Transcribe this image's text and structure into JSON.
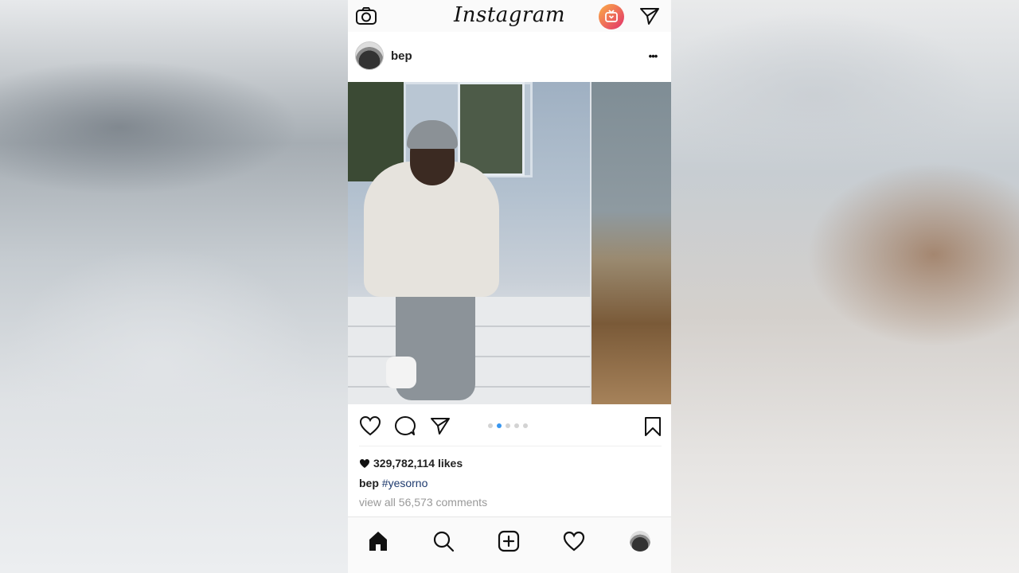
{
  "app": {
    "title": "Instagram"
  },
  "post": {
    "username": "bep",
    "more_label": "•••",
    "likes": "329,782,114 likes",
    "caption_user": "bep",
    "caption_tag": "#yesorno",
    "view_comments": "view all 56,573 comments"
  },
  "carousel": {
    "count": 5,
    "active_index": 1
  },
  "colors": {
    "active_dot": "#3897f0",
    "hashtag": "#1e3a6e",
    "igtv_gradient": [
      "#fcaf45",
      "#e1306c"
    ]
  },
  "icons": {
    "top": [
      "camera-icon",
      "igtv-icon",
      "direct-message-icon"
    ],
    "actions": [
      "like-icon",
      "comment-icon",
      "share-icon",
      "bookmark-icon"
    ],
    "tabs": [
      "home-icon",
      "search-icon",
      "new-post-icon",
      "activity-icon",
      "profile-icon"
    ]
  }
}
